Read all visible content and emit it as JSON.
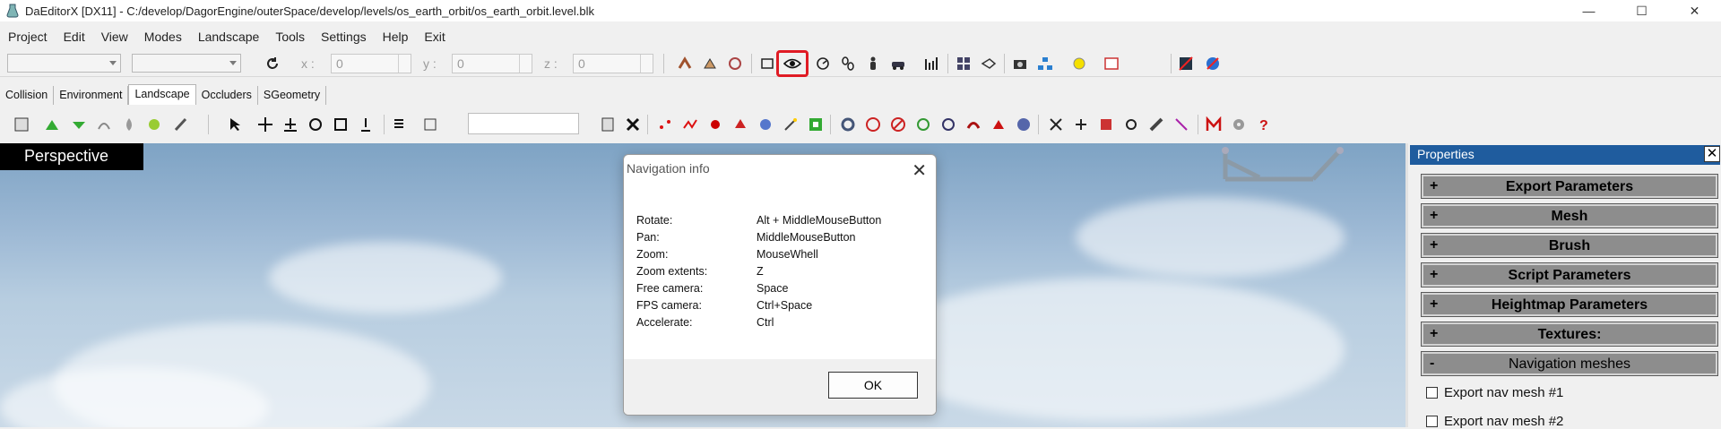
{
  "titlebar": {
    "title": "DaEditorX  [DX11]  - C:/develop/DagorEngine/outerSpace/develop/levels/os_earth_orbit/os_earth_orbit.level.blk",
    "minimize": "—",
    "maximize": "☐",
    "close": "✕"
  },
  "menu": [
    "Project",
    "Edit",
    "View",
    "Modes",
    "Landscape",
    "Tools",
    "Settings",
    "Help",
    "Exit"
  ],
  "toolbar1": {
    "x_label": "x :",
    "y_label": "y :",
    "z_label": "z :",
    "x_value": "0",
    "y_value": "0",
    "z_value": "0"
  },
  "tabs": [
    "Collision",
    "Environment",
    "Landscape",
    "Occluders",
    "SGeometry"
  ],
  "active_tab": "Landscape",
  "viewport": {
    "label": "Perspective"
  },
  "dialog": {
    "title": "Navigation info",
    "close": "✕",
    "rows": [
      {
        "key": "Rotate:",
        "value": "Alt + MiddleMouseButton"
      },
      {
        "key": "Pan:",
        "value": "MiddleMouseButton"
      },
      {
        "key": "Zoom:",
        "value": "MouseWhell"
      },
      {
        "key": "Zoom extents:",
        "value": "Z"
      },
      {
        "key": "Free camera:",
        "value": "Space"
      },
      {
        "key": "FPS camera:",
        "value": "Ctrl+Space"
      },
      {
        "key": "Accelerate:",
        "value": "Ctrl"
      }
    ],
    "ok": "OK"
  },
  "properties": {
    "header": "Properties",
    "close": "✕",
    "sections": [
      {
        "sign": "+",
        "label": "Export Parameters"
      },
      {
        "sign": "+",
        "label": "Mesh"
      },
      {
        "sign": "+",
        "label": "Brush"
      },
      {
        "sign": "+",
        "label": "Script Parameters"
      },
      {
        "sign": "+",
        "label": "Heightmap Parameters"
      },
      {
        "sign": "+",
        "label": "Textures:"
      },
      {
        "sign": "-",
        "label": "Navigation meshes"
      }
    ],
    "checks": [
      "Export nav mesh #1",
      "Export nav mesh #2"
    ]
  },
  "colors": {
    "highlight": "#e01b24",
    "props_header": "#1f5c9e"
  }
}
